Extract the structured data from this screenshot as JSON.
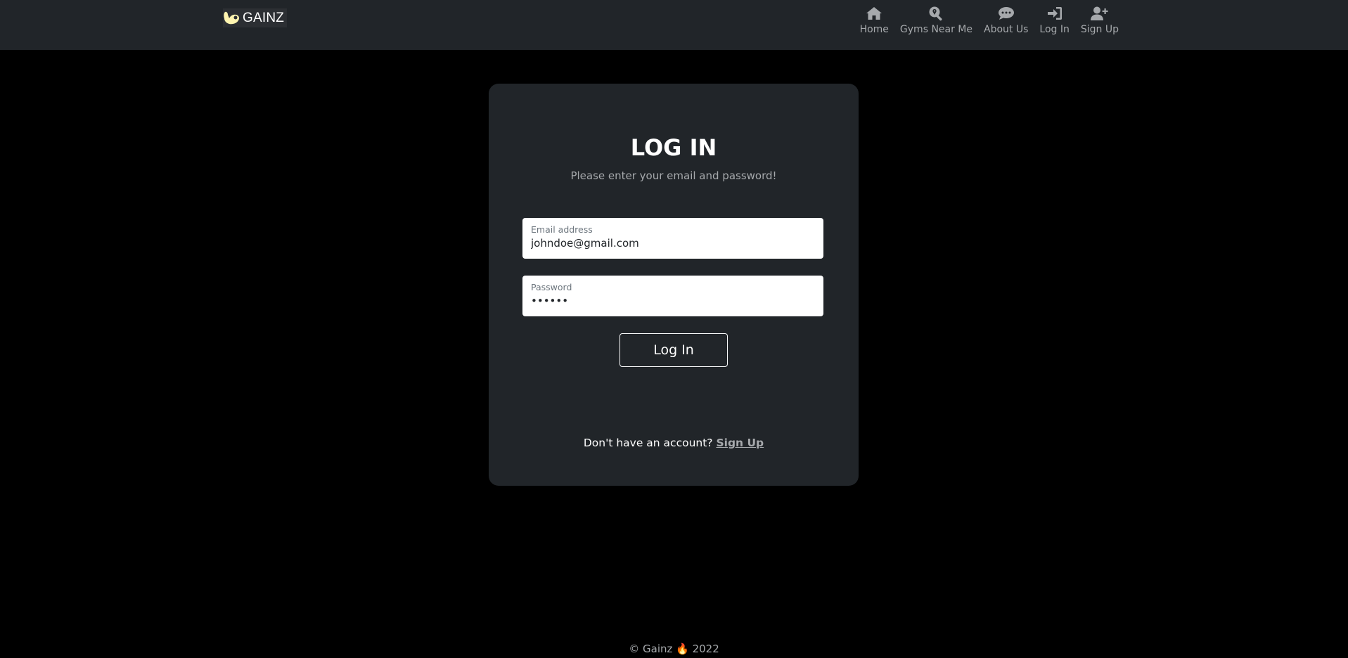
{
  "brand": {
    "name": "GAINZ"
  },
  "nav": {
    "items": [
      {
        "label": "Home",
        "icon": "home-icon"
      },
      {
        "label": "Gyms Near Me",
        "icon": "search-location-icon"
      },
      {
        "label": "About Us",
        "icon": "comment-dots-icon"
      },
      {
        "label": "Log In",
        "icon": "sign-in-icon"
      },
      {
        "label": "Sign Up",
        "icon": "user-plus-icon"
      }
    ]
  },
  "login": {
    "title": "LOG IN",
    "subtitle": "Please enter your email and password!",
    "email_label": "Email address",
    "email_value": "johndoe@gmail.com",
    "password_label": "Password",
    "password_value": "••••••",
    "submit_label": "Log In",
    "signup_prompt": "Don't have an account?",
    "signup_link": "Sign Up"
  },
  "footer": {
    "text": "© Gainz 🔥 2022"
  },
  "colors": {
    "navbar_bg": "#212529",
    "page_bg": "#000000",
    "card_bg": "#212529",
    "muted_text": "#a6a9ac",
    "logo_accent": "#fff5b0"
  }
}
